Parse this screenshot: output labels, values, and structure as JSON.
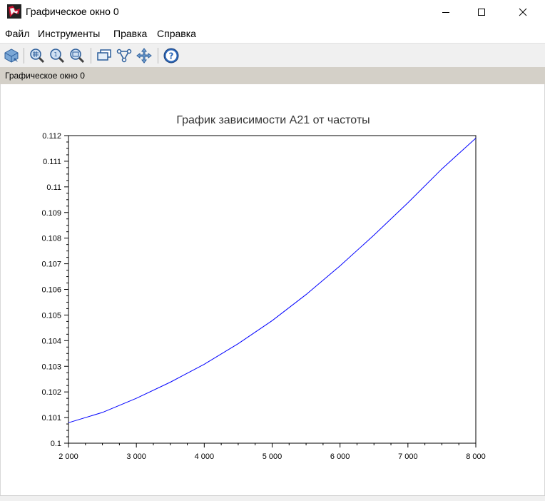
{
  "window": {
    "title": "Графическое окно 0"
  },
  "menu": {
    "file": "Файл",
    "tools": "Инструменты",
    "edit": "Правка",
    "help": "Справка"
  },
  "toolbar": {
    "icons": [
      "rotate-icon",
      "zoom-area-icon",
      "zoom-in-icon",
      "zoom-out-icon",
      "datatip-icon",
      "graph-icon",
      "pan-icon",
      "help-icon"
    ]
  },
  "figure_label": "Графическое окно 0",
  "chart_data": {
    "type": "line",
    "title": "График зависимости А21 от частоты",
    "xlabel": "",
    "ylabel": "",
    "xlim": [
      2000,
      8000
    ],
    "ylim": [
      0.1,
      0.112
    ],
    "x_ticks": [
      2000,
      3000,
      4000,
      5000,
      6000,
      7000,
      8000
    ],
    "x_tick_labels": [
      "2 000",
      "3 000",
      "4 000",
      "5 000",
      "6 000",
      "7 000",
      "8 000"
    ],
    "y_ticks": [
      0.1,
      0.101,
      0.102,
      0.103,
      0.104,
      0.105,
      0.106,
      0.107,
      0.108,
      0.109,
      0.11,
      0.111,
      0.112
    ],
    "y_tick_labels": [
      "0.1",
      "0.101",
      "0.102",
      "0.103",
      "0.104",
      "0.105",
      "0.106",
      "0.107",
      "0.108",
      "0.109",
      "0.11",
      "0.111",
      "0.112"
    ],
    "grid": false,
    "series": [
      {
        "color": "#0000ff",
        "x": [
          2000,
          2500,
          3000,
          3500,
          4000,
          4500,
          5000,
          5500,
          6000,
          6500,
          7000,
          7500,
          8000
        ],
        "values": [
          0.1008,
          0.1012,
          0.10175,
          0.10238,
          0.10308,
          0.10388,
          0.10478,
          0.1058,
          0.10692,
          0.10812,
          0.10938,
          0.1107,
          0.1119
        ]
      }
    ]
  }
}
